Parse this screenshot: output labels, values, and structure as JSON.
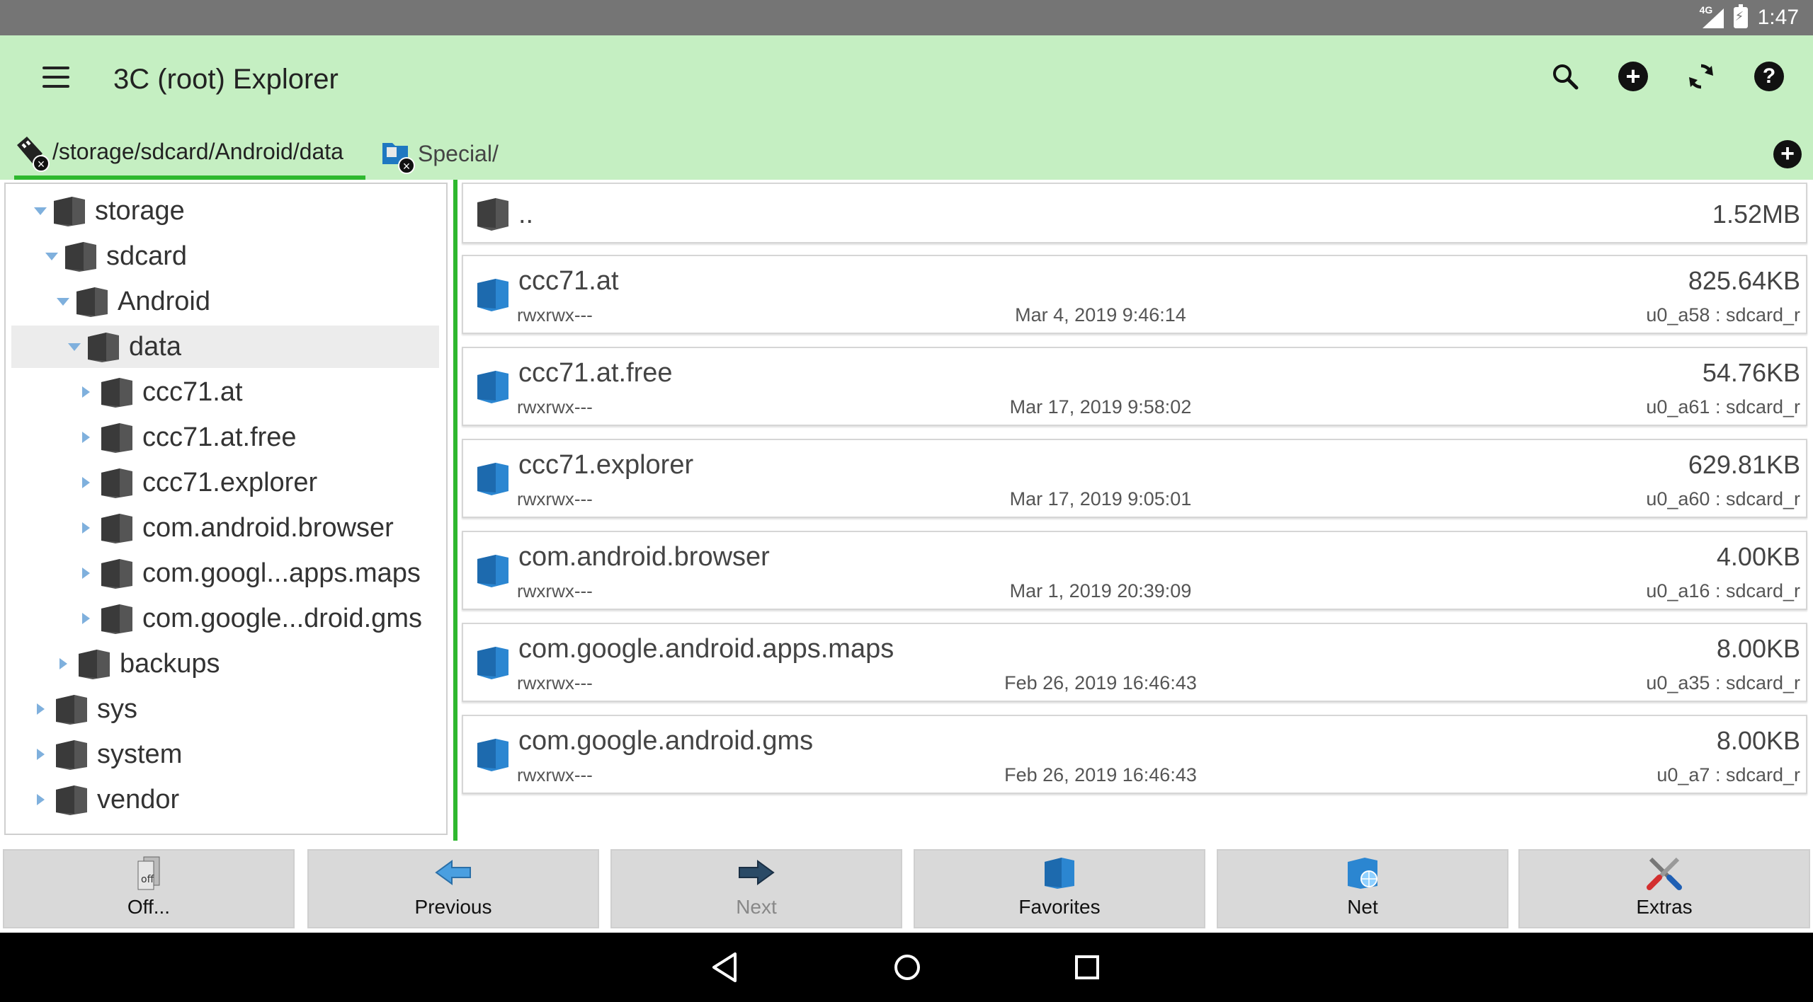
{
  "status_bar": {
    "network": "4G",
    "time": "1:47"
  },
  "toolbar": {
    "title": "3C (root) Explorer",
    "icons": [
      "menu-icon",
      "search-icon",
      "add-circle-icon",
      "refresh-icon",
      "help-icon"
    ]
  },
  "tabs": [
    {
      "label": "/storage/sdcard/Android/data",
      "active": true
    },
    {
      "label": "Special/",
      "active": false
    }
  ],
  "tree": [
    {
      "label": "storage",
      "expanded": true
    },
    {
      "label": "sdcard",
      "expanded": true
    },
    {
      "label": "Android",
      "expanded": true
    },
    {
      "label": "data",
      "expanded": true,
      "selected": true
    },
    {
      "label": "ccc71.at",
      "expanded": false
    },
    {
      "label": "ccc71.at.free",
      "expanded": false
    },
    {
      "label": "ccc71.explorer",
      "expanded": false
    },
    {
      "label": "com.android.browser",
      "expanded": false
    },
    {
      "label": "com.googl...apps.maps",
      "expanded": false
    },
    {
      "label": "com.google...droid.gms",
      "expanded": false
    },
    {
      "label": "backups",
      "expanded": false
    },
    {
      "label": "sys",
      "expanded": false
    },
    {
      "label": "system",
      "expanded": false
    },
    {
      "label": "vendor",
      "expanded": false
    }
  ],
  "parent_row": {
    "name": "..",
    "size": "1.52MB"
  },
  "files": [
    {
      "name": "ccc71.at",
      "perm": "rwxrwx---",
      "date": "Mar 4, 2019 9:46:14",
      "size": "825.64KB",
      "owner": "u0_a58 : sdcard_r"
    },
    {
      "name": "ccc71.at.free",
      "perm": "rwxrwx---",
      "date": "Mar 17, 2019 9:58:02",
      "size": "54.76KB",
      "owner": "u0_a61 : sdcard_r"
    },
    {
      "name": "ccc71.explorer",
      "perm": "rwxrwx---",
      "date": "Mar 17, 2019 9:05:01",
      "size": "629.81KB",
      "owner": "u0_a60 : sdcard_r"
    },
    {
      "name": "com.android.browser",
      "perm": "rwxrwx---",
      "date": "Mar 1, 2019 20:39:09",
      "size": "4.00KB",
      "owner": "u0_a16 : sdcard_r"
    },
    {
      "name": "com.google.android.apps.maps",
      "perm": "rwxrwx---",
      "date": "Feb 26, 2019 16:46:43",
      "size": "8.00KB",
      "owner": "u0_a35 : sdcard_r"
    },
    {
      "name": "com.google.android.gms",
      "perm": "rwxrwx---",
      "date": "Feb 26, 2019 16:46:43",
      "size": "8.00KB",
      "owner": "u0_a7 : sdcard_r"
    }
  ],
  "bottom_buttons": [
    {
      "label": "Off...",
      "icon": "office-files-icon",
      "enabled": true
    },
    {
      "label": "Previous",
      "icon": "arrow-left-icon",
      "enabled": true
    },
    {
      "label": "Next",
      "icon": "arrow-right-icon",
      "enabled": false
    },
    {
      "label": "Favorites",
      "icon": "favorites-folder-icon",
      "enabled": true
    },
    {
      "label": "Net",
      "icon": "network-folder-icon",
      "enabled": true
    },
    {
      "label": "Extras",
      "icon": "tools-icon",
      "enabled": true
    }
  ],
  "colors": {
    "toolbar_bg": "#c5efc2",
    "accent_green": "#2fb82f",
    "folder_blue": "#1f78c1",
    "folder_gray": "#555555"
  }
}
